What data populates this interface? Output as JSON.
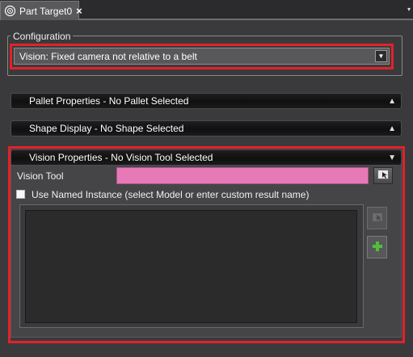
{
  "tab": {
    "title": "Part Target0",
    "close_glyph": "×",
    "icon": "target-gear-icon",
    "menu_caret": "▾"
  },
  "configuration": {
    "legend": "Configuration",
    "selected_value": "Vision: Fixed camera not relative to a belt",
    "dropdown_glyph": "▼"
  },
  "sections": {
    "pallet": {
      "label": "Pallet Properties - No Pallet Selected",
      "arrow": "▲"
    },
    "shape": {
      "label": "Shape Display - No Shape Selected",
      "arrow": "▲"
    },
    "vision": {
      "label": "Vision Properties - No Vision Tool Selected",
      "arrow": "▼"
    }
  },
  "vision_properties": {
    "tool_label": "Vision Tool",
    "tool_value": "",
    "use_named_instance_label": "Use Named Instance (select Model or enter custom result name)",
    "use_named_instance_checked": false
  },
  "colors": {
    "highlight": "#e2222a",
    "vision_tool_field": "#e67ab6",
    "background": "#3a3a3c"
  }
}
